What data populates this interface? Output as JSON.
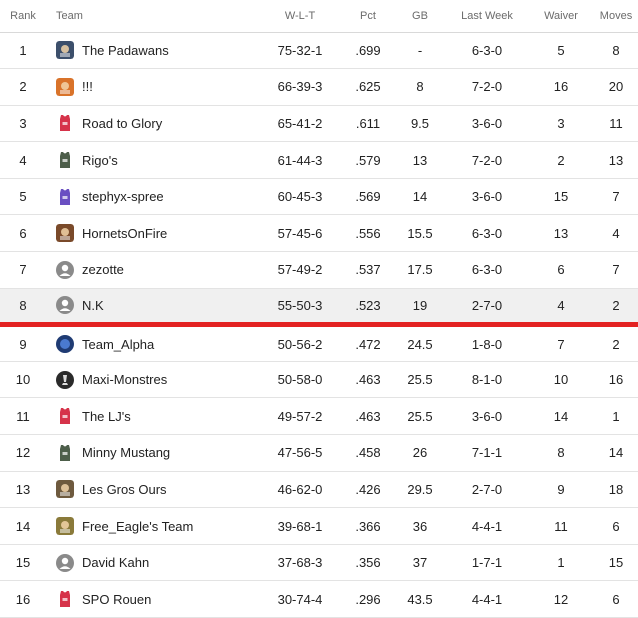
{
  "columns": {
    "rank": "Rank",
    "team": "Team",
    "wlt": "W-L-T",
    "pct": "Pct",
    "gb": "GB",
    "last_week": "Last Week",
    "waiver": "Waiver",
    "moves": "Moves"
  },
  "teams": [
    {
      "rank": "1",
      "name": "The Padawans",
      "wlt": "75-32-1",
      "pct": ".699",
      "gb": "-",
      "last_week": "6-3-0",
      "waiver": "5",
      "moves": "8",
      "icon": "padawan-icon",
      "color": "#3c4f6b"
    },
    {
      "rank": "2",
      "name": "!!!",
      "wlt": "66-39-3",
      "pct": ".625",
      "gb": "8",
      "last_week": "7-2-0",
      "waiver": "16",
      "moves": "20",
      "icon": "cartoon-face-icon",
      "color": "#d9732a"
    },
    {
      "rank": "3",
      "name": "Road to Glory",
      "wlt": "65-41-2",
      "pct": ".611",
      "gb": "9.5",
      "last_week": "3-6-0",
      "waiver": "3",
      "moves": "11",
      "icon": "red-jersey-icon",
      "color": "#d6334a"
    },
    {
      "rank": "4",
      "name": "Rigo's",
      "wlt": "61-44-3",
      "pct": ".579",
      "gb": "13",
      "last_week": "7-2-0",
      "waiver": "2",
      "moves": "13",
      "icon": "green-jersey-icon",
      "color": "#4d5e4a"
    },
    {
      "rank": "5",
      "name": "stephyx-spree",
      "wlt": "60-45-3",
      "pct": ".569",
      "gb": "14",
      "last_week": "3-6-0",
      "waiver": "15",
      "moves": "7",
      "icon": "purple-jersey-icon",
      "color": "#6a4fc2"
    },
    {
      "rank": "6",
      "name": "HornetsOnFire",
      "wlt": "57-45-6",
      "pct": ".556",
      "gb": "15.5",
      "last_week": "6-3-0",
      "waiver": "13",
      "moves": "4",
      "icon": "hornets-logo-icon",
      "color": "#7a4a2a"
    },
    {
      "rank": "7",
      "name": "zezotte",
      "wlt": "57-49-2",
      "pct": ".537",
      "gb": "17.5",
      "last_week": "6-3-0",
      "waiver": "6",
      "moves": "7",
      "icon": "default-avatar-icon",
      "color": "#8a8a8a"
    },
    {
      "rank": "8",
      "name": "N.K",
      "wlt": "55-50-3",
      "pct": ".523",
      "gb": "19",
      "last_week": "2-7-0",
      "waiver": "4",
      "moves": "2",
      "icon": "default-avatar-icon",
      "color": "#8a8a8a"
    },
    {
      "rank": "9",
      "name": "Team_Alpha",
      "wlt": "50-56-2",
      "pct": ".472",
      "gb": "24.5",
      "last_week": "1-8-0",
      "waiver": "7",
      "moves": "2",
      "icon": "alpha-logo-icon",
      "color": "#1f3b73"
    },
    {
      "rank": "10",
      "name": "Maxi-Monstres",
      "wlt": "50-58-0",
      "pct": ".463",
      "gb": "25.5",
      "last_week": "8-1-0",
      "waiver": "10",
      "moves": "16",
      "icon": "trophy-icon",
      "color": "#2a2a2a"
    },
    {
      "rank": "11",
      "name": "The LJ's",
      "wlt": "49-57-2",
      "pct": ".463",
      "gb": "25.5",
      "last_week": "3-6-0",
      "waiver": "14",
      "moves": "1",
      "icon": "red-jersey-icon",
      "color": "#d6334a"
    },
    {
      "rank": "12",
      "name": "Minny Mustang",
      "wlt": "47-56-5",
      "pct": ".458",
      "gb": "26",
      "last_week": "7-1-1",
      "waiver": "8",
      "moves": "14",
      "icon": "green-jersey-icon",
      "color": "#4d5e4a"
    },
    {
      "rank": "13",
      "name": "Les Gros Ours",
      "wlt": "46-62-0",
      "pct": ".426",
      "gb": "29.5",
      "last_week": "2-7-0",
      "waiver": "9",
      "moves": "18",
      "icon": "bear-logo-icon",
      "color": "#6e5a3e"
    },
    {
      "rank": "14",
      "name": "Free_Eagle's Team",
      "wlt": "39-68-1",
      "pct": ".366",
      "gb": "36",
      "last_week": "4-4-1",
      "waiver": "11",
      "moves": "6",
      "icon": "eagle-logo-icon",
      "color": "#8a7a3a"
    },
    {
      "rank": "15",
      "name": "David Kahn",
      "wlt": "37-68-3",
      "pct": ".356",
      "gb": "37",
      "last_week": "1-7-1",
      "waiver": "1",
      "moves": "15",
      "icon": "default-avatar-icon",
      "color": "#8a8a8a"
    },
    {
      "rank": "16",
      "name": "SPO Rouen",
      "wlt": "30-74-4",
      "pct": ".296",
      "gb": "43.5",
      "last_week": "4-4-1",
      "waiver": "12",
      "moves": "6",
      "icon": "red-jersey-icon",
      "color": "#d6334a"
    }
  ],
  "highlight_rank": "8",
  "playoff_cutline_after_rank": "8",
  "cutline_color": "#e32222"
}
